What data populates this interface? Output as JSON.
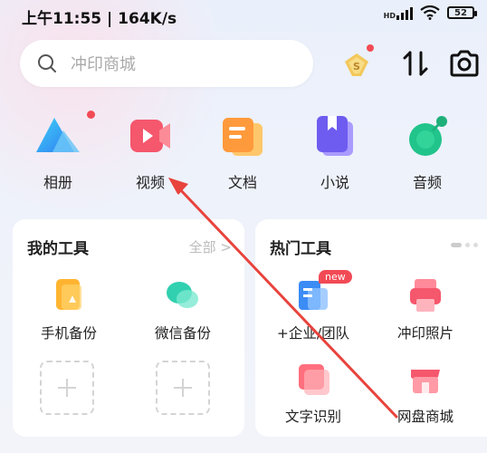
{
  "status": {
    "time": "上午11:55 | 164K/s",
    "network_tag": "HD",
    "battery": "52"
  },
  "search": {
    "placeholder": "冲印商城"
  },
  "nav": {
    "items": [
      {
        "label": "相册",
        "icon": "album-icon"
      },
      {
        "label": "视频",
        "icon": "video-icon"
      },
      {
        "label": "文档",
        "icon": "document-icon"
      },
      {
        "label": "小说",
        "icon": "novel-icon"
      },
      {
        "label": "音频",
        "icon": "audio-icon"
      }
    ]
  },
  "my_tools": {
    "title": "我的工具",
    "more": "全部 >",
    "items": [
      {
        "label": "手机备份",
        "icon": "phone-backup-icon"
      },
      {
        "label": "微信备份",
        "icon": "wechat-backup-icon"
      }
    ]
  },
  "hot_tools": {
    "title": "热门工具",
    "items": [
      {
        "label": "+企业/团队",
        "icon": "enterprise-team-icon",
        "badge": "new"
      },
      {
        "label": "冲印照片",
        "icon": "print-photo-icon"
      },
      {
        "label": "文字识别",
        "icon": "ocr-icon"
      },
      {
        "label": "网盘商城",
        "icon": "store-icon"
      }
    ]
  },
  "colors": {
    "accent_red": "#f24a55",
    "annotation_arrow": "#e8433d"
  }
}
